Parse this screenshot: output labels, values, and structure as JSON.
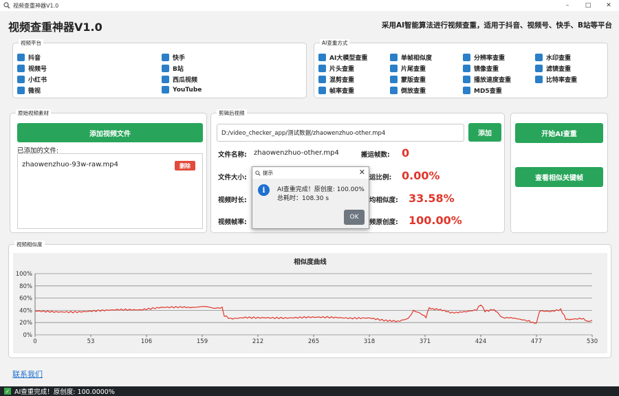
{
  "window": {
    "title": "视频查重神器V1.0",
    "minimize": "–",
    "maximize": "□",
    "close": "✕"
  },
  "header": {
    "app_title": "视频查重神器V1.0",
    "tagline": "采用AI智能算法进行视频查重，适用于抖音、视频号、快手、B站等平台"
  },
  "platforms": {
    "label": "视频平台",
    "items": [
      "抖音",
      "快手",
      "视频号",
      "B站",
      "小红书",
      "西瓜视频",
      "微视",
      "YouTube"
    ]
  },
  "methods": {
    "label": "AI查重方式",
    "items": [
      "AI大模型查重",
      "单帧相似度",
      "分辨率查重",
      "水印查重",
      "片头查重",
      "片尾查重",
      "镜像查重",
      "滤镜查重",
      "混剪查重",
      "蒙版查重",
      "播放速度查重",
      "比特率查重",
      "帧率查重",
      "倒放查重",
      "MD5查重"
    ]
  },
  "source": {
    "label": "原始视频素材",
    "add_button": "添加视频文件",
    "added_label": "已添加的文件:",
    "file_name": "zhaowenzhuo-93w-raw.mp4",
    "delete_button": "删除"
  },
  "edited": {
    "label": "剪辑后视频",
    "path": "D:/video_checker_app/测试数据/zhaowenzhuo-other.mp4",
    "add_button": "添加",
    "file_name_label": "文件名称:",
    "file_name_value": "zhaowenzhuo-other.mp4",
    "file_size_label": "文件大小:",
    "duration_label": "视频时长:",
    "fps_label": "视频帧率:",
    "moved_frames_label": "搬运帧数:",
    "moved_frames_value": "0",
    "moved_ratio_label": "运比例:",
    "moved_ratio_value": "0.00%",
    "avg_sim_label": "均相似度:",
    "avg_sim_value": "33.58%",
    "originality_label": "频原创度:",
    "originality_value": "100.00%"
  },
  "actions": {
    "start_button": "开始AI查重",
    "view_keyframes_button": "查看相似关键帧"
  },
  "similarity": {
    "label": "视频相似度"
  },
  "chart_data": {
    "type": "line",
    "title": "相似度曲线",
    "xlabel": "",
    "ylabel": "",
    "x_ticks": [
      0,
      53,
      106,
      159,
      212,
      265,
      318,
      371,
      424,
      477,
      530
    ],
    "y_ticks": [
      "0%",
      "20%",
      "40%",
      "60%",
      "80%",
      "100%"
    ],
    "xlim": [
      0,
      530
    ],
    "ylim": [
      0,
      100
    ],
    "grid": true,
    "color": "#e0362a",
    "series": [
      {
        "values_xy": [
          [
            0,
            39
          ],
          [
            20,
            38
          ],
          [
            40,
            38
          ],
          [
            60,
            40
          ],
          [
            80,
            41
          ],
          [
            100,
            40
          ],
          [
            120,
            44
          ],
          [
            140,
            45
          ],
          [
            159,
            46
          ],
          [
            170,
            44
          ],
          [
            178,
            45
          ],
          [
            180,
            32
          ],
          [
            186,
            27
          ],
          [
            200,
            29
          ],
          [
            220,
            28
          ],
          [
            240,
            27
          ],
          [
            260,
            28
          ],
          [
            280,
            28
          ],
          [
            300,
            27
          ],
          [
            318,
            28
          ],
          [
            330,
            25
          ],
          [
            345,
            21
          ],
          [
            355,
            26
          ],
          [
            360,
            40
          ],
          [
            366,
            36
          ],
          [
            372,
            29
          ],
          [
            375,
            44
          ],
          [
            380,
            42
          ],
          [
            395,
            37
          ],
          [
            410,
            37
          ],
          [
            420,
            40
          ],
          [
            424,
            49
          ],
          [
            428,
            38
          ],
          [
            435,
            42
          ],
          [
            440,
            36
          ],
          [
            445,
            28
          ],
          [
            460,
            26
          ],
          [
            470,
            23
          ],
          [
            477,
            18
          ],
          [
            480,
            40
          ],
          [
            490,
            39
          ],
          [
            500,
            42
          ],
          [
            505,
            25
          ],
          [
            510,
            26
          ],
          [
            520,
            27
          ],
          [
            525,
            22
          ],
          [
            530,
            24
          ]
        ]
      }
    ]
  },
  "dialog": {
    "title": "提示",
    "line1": "AI查重完成！原创度: 100.00%",
    "line2": "总耗时：108.30 s",
    "ok_button": "OK",
    "close": "✕",
    "info_glyph": "i"
  },
  "footer": {
    "contact_link": "联系我们"
  },
  "statusbar": {
    "text": "AI查重完成！原创度: 100.0000%",
    "check": "✓"
  }
}
